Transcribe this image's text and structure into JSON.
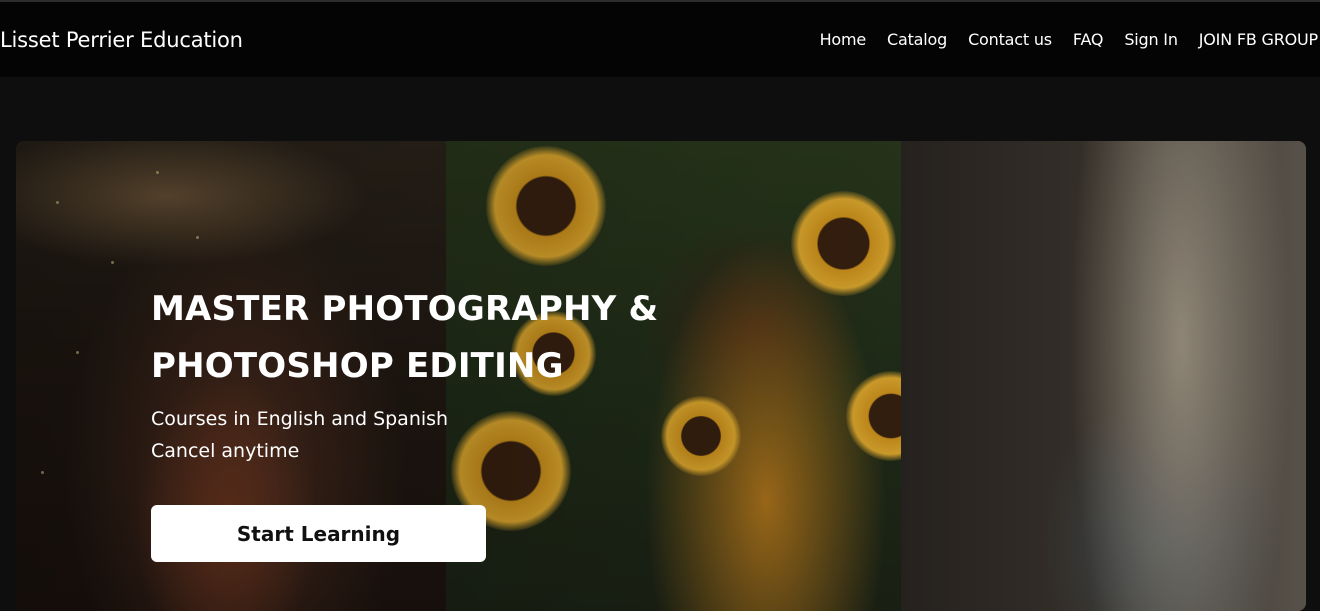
{
  "header": {
    "brand": "Lisset Perrier Education",
    "nav": [
      "Home",
      "Catalog",
      "Contact us",
      "FAQ",
      "Sign In",
      "JOIN FB GROUP"
    ]
  },
  "hero": {
    "title_line1": "MASTER PHOTOGRAPHY &",
    "title_line2": "PHOTOSHOP EDITING",
    "sub_line1": "Courses in English and Spanish",
    "sub_line2": "Cancel anytime",
    "cta_label": "Start Learning",
    "images": [
      "girl-with-butterflies-photo",
      "girl-with-sunflowers-photo",
      "boy-with-dog-photo"
    ]
  },
  "colors": {
    "header_bg": "#040404",
    "page_bg": "#0e0e0e",
    "cta_bg": "#ffffff"
  }
}
